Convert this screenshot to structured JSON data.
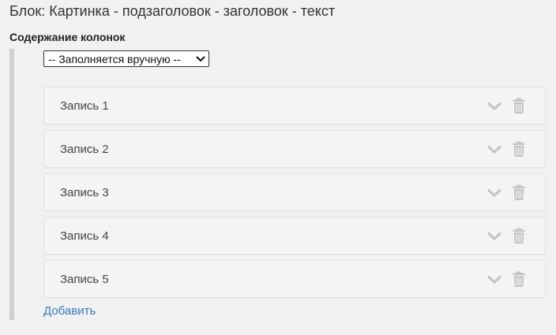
{
  "block": {
    "title": "Блок: Картинка - подзаголовок - заголовок - текст"
  },
  "columns": {
    "section_label": "Содержание колонок",
    "source_select": {
      "selected": "-- Заполняется вручную --"
    },
    "entries": [
      {
        "label": "Запись 1"
      },
      {
        "label": "Запись 2"
      },
      {
        "label": "Запись 3"
      },
      {
        "label": "Запись 4"
      },
      {
        "label": "Запись 5"
      }
    ],
    "add_label": "Добавить"
  },
  "icons": {
    "entry_toggle": "chevron-down-icon",
    "entry_delete": "trash-icon",
    "select_arrow": "chevron-down-icon"
  },
  "colors": {
    "background": "#f1f1f1",
    "entry_background": "#f4f4f4",
    "entry_border": "#e0e0e0",
    "left_bar": "#d0d0d0",
    "icon_muted": "#c4c4c4",
    "link": "#3a78b8"
  }
}
